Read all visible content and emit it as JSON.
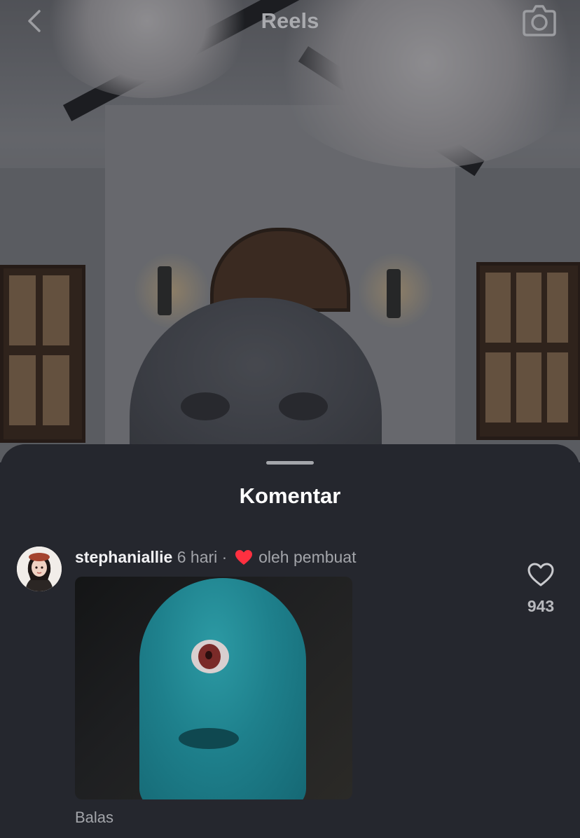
{
  "topbar": {
    "title": "Reels",
    "back_icon": "chevron-left-icon",
    "camera_icon": "camera-icon"
  },
  "sheet": {
    "title": "Komentar"
  },
  "comment": {
    "username": "stephaniallie",
    "time": "6 hari",
    "separator": "·",
    "liked_by_creator_icon": "heart-filled-icon",
    "liked_by_creator_label": "oleh pembuat",
    "reply_label": "Balas",
    "like_icon": "heart-outline-icon",
    "like_count": "943"
  },
  "colors": {
    "sheet_background": "#25272e",
    "heart_red": "#ff3040",
    "text_primary": "#ffffff",
    "text_secondary": "#a3a5aa"
  }
}
